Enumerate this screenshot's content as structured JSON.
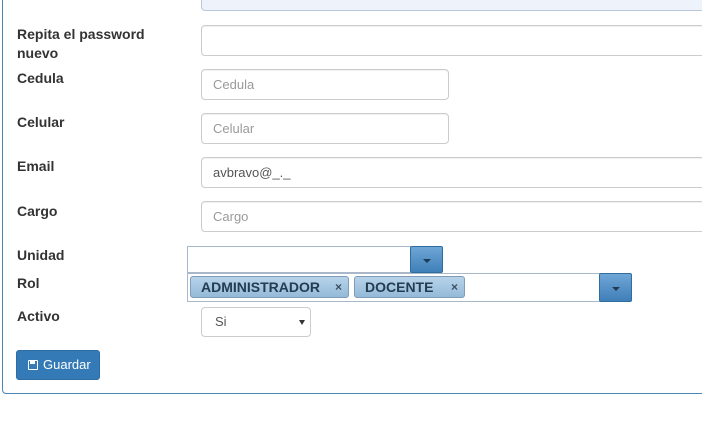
{
  "form": {
    "repeat_password": {
      "label": "Repita el password nuevo",
      "value": ""
    },
    "cedula": {
      "label": "Cedula",
      "placeholder": "Cedula",
      "value": ""
    },
    "celular": {
      "label": "Celular",
      "placeholder": "Celular",
      "value": ""
    },
    "email": {
      "label": "Email",
      "value": "avbravo@_._"
    },
    "cargo": {
      "label": "Cargo",
      "placeholder": "Cargo",
      "value": ""
    },
    "unidad": {
      "label": "Unidad",
      "value": "",
      "toggle_icon": "chevron-down-icon"
    },
    "rol": {
      "label": "Rol",
      "tags": [
        {
          "label": "ADMINISTRADOR",
          "remove_icon": "×"
        },
        {
          "label": "DOCENTE",
          "remove_icon": "×"
        }
      ],
      "toggle_icon": "chevron-down-icon"
    },
    "activo": {
      "label": "Activo",
      "selected": "Si"
    }
  },
  "actions": {
    "save_label": "Guardar",
    "save_icon": "floppy-disk-icon"
  },
  "colors": {
    "primary": "#337ab7",
    "panel_border": "#4a86b4",
    "tag_bg": "#a6c7e1",
    "combo_button": "#4f8cc5"
  }
}
